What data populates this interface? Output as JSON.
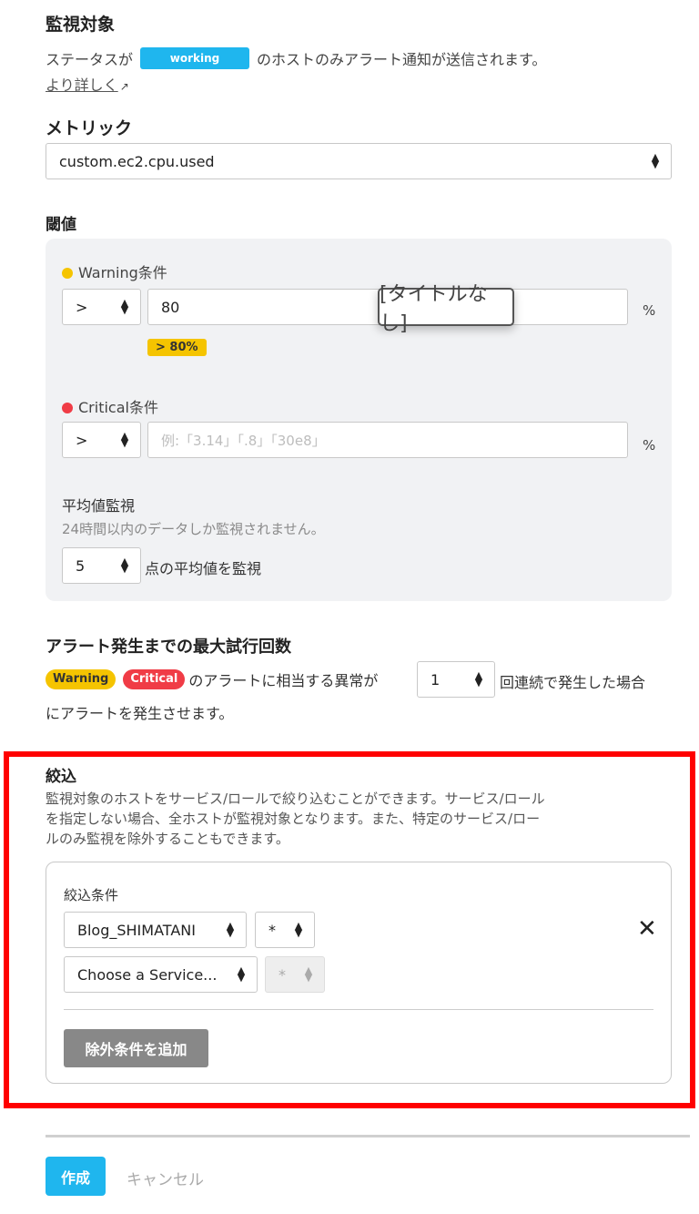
{
  "monitor_target": {
    "title": "監視対象",
    "prefix": "ステータスが",
    "status_badge": "working",
    "suffix": "のホストのみアラート通知が送信されます。",
    "more_link": "より詳しく"
  },
  "metric": {
    "title": "メトリック",
    "selected": "custom.ec2.cpu.used"
  },
  "threshold": {
    "title": "閾値",
    "warning": {
      "label": "Warning条件",
      "operator": ">",
      "value": "80",
      "unit": "%",
      "preview": "> 80%",
      "color": "#f5c400"
    },
    "critical": {
      "label": "Critical条件",
      "operator": ">",
      "placeholder": "例:「3.14」「.8」「30e8」",
      "unit": "%",
      "color": "#f03c46"
    },
    "average": {
      "title": "平均値監視",
      "note": "24時間以内のデータしか監視されません。",
      "points": "5",
      "suffix": "点の平均値を監視"
    },
    "tooltip": "[タイトルなし]"
  },
  "retry": {
    "title": "アラート発生までの最大試行回数",
    "warning_pill": "Warning",
    "critical_pill": "Critical",
    "text_before": "のアラートに相当する異常が",
    "count": "1",
    "text_after": "回連続で発生した場合",
    "text_line2": "にアラートを発生させます。"
  },
  "filter": {
    "title": "絞込",
    "desc_line1": "監視対象のホストをサービス/ロールで絞り込むことができます。サービス/ロール",
    "desc_line2": "を指定しない場合、全ホストが監視対象となります。また、特定のサービス/ロー",
    "desc_line3": "ルのみ監視を除外することもできます。",
    "condition_label": "絞込条件",
    "service_selected": "Blog_SHIMATANI",
    "role_selected": "*",
    "service_placeholder": "Choose a Service...",
    "role_disabled": "*",
    "add_exclude_button": "除外条件を追加"
  },
  "footer": {
    "create_button": "作成",
    "cancel_link": "キャンセル"
  },
  "colors": {
    "accent": "#1fb6ee",
    "highlight_frame": "#ff0000",
    "warning": "#f5c400",
    "critical": "#f03c46"
  }
}
